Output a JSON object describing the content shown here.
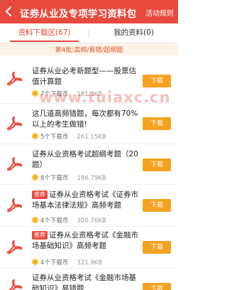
{
  "header": {
    "title": "证券从业及专项学习资料包",
    "rule_link": "活动规则"
  },
  "tabs": [
    {
      "label": "资料下载区(67)"
    },
    {
      "label": "我的资料(0)"
    }
  ],
  "banner": {
    "text": "第4批:高频/易错/超纲题"
  },
  "items": [
    {
      "title": "证券从业必考新题型——股票估值计算题",
      "hot": false,
      "downloads": "7个下载币",
      "size": "181.3KB",
      "button": "下载"
    },
    {
      "title": "这几道高频错题，每次都有70%以上的考生做错!",
      "hot": false,
      "downloads": "5个下载币",
      "size": "261.15KB",
      "button": "下载"
    },
    {
      "title": "证券从业资格考试超纲考题（20题）",
      "hot": false,
      "downloads": "8个下载币",
      "size": "186.79KB",
      "button": "下载"
    },
    {
      "title": "证券从业资格考试《证券市场基本法律法规》高频考题",
      "hot": true,
      "hot_label": "推荐",
      "downloads": "4个下载币",
      "size": "300.76KB",
      "button": "下载"
    },
    {
      "title": "证券从业资格考试《金融市场基础知识》高频考题",
      "hot": true,
      "hot_label": "推荐",
      "downloads": "4个下载币",
      "size": "321.9KB",
      "button": "下载"
    },
    {
      "title": "证券从业资格考试《金融市场基础知识》易错题",
      "hot": false,
      "downloads": "",
      "size": "",
      "button": "下载"
    }
  ],
  "watermark": "www.tuiaxc.cn",
  "colors": {
    "brand": "#e8493d",
    "button": "#f4a21f"
  }
}
